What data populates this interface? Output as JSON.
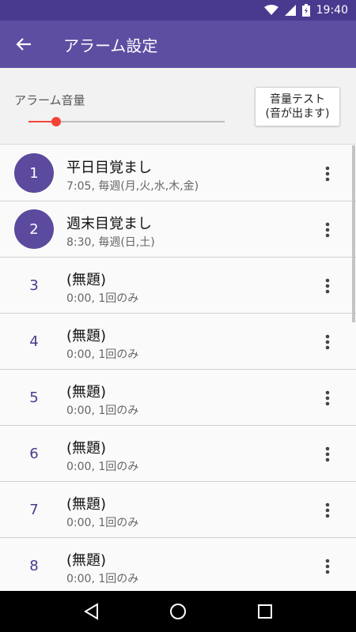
{
  "status_bar": {
    "time": "19:40"
  },
  "app_bar": {
    "title": "アラーム設定",
    "back_icon": "arrow-back-icon"
  },
  "volume": {
    "label": "アラーム音量",
    "level": 0.14,
    "test_button_line1": "音量テスト",
    "test_button_line2": "(音が出ます)"
  },
  "alarms": [
    {
      "number": "1",
      "title": "平日目覚まし",
      "subtitle": "7:05, 毎週(月,火,水,木,金)",
      "active": true
    },
    {
      "number": "2",
      "title": "週末目覚まし",
      "subtitle": "8:30, 毎週(日,土)",
      "active": true
    },
    {
      "number": "3",
      "title": "(無題)",
      "subtitle": "0:00, 1回のみ",
      "active": false
    },
    {
      "number": "4",
      "title": "(無題)",
      "subtitle": "0:00, 1回のみ",
      "active": false
    },
    {
      "number": "5",
      "title": "(無題)",
      "subtitle": "0:00, 1回のみ",
      "active": false
    },
    {
      "number": "6",
      "title": "(無題)",
      "subtitle": "0:00, 1回のみ",
      "active": false
    },
    {
      "number": "7",
      "title": "(無題)",
      "subtitle": "0:00, 1回のみ",
      "active": false
    },
    {
      "number": "8",
      "title": "(無題)",
      "subtitle": "0:00, 1回のみ",
      "active": false
    }
  ],
  "colors": {
    "primary": "#5e4ea2",
    "primary_dark": "#4a3a8f",
    "accent": "#f44336"
  }
}
